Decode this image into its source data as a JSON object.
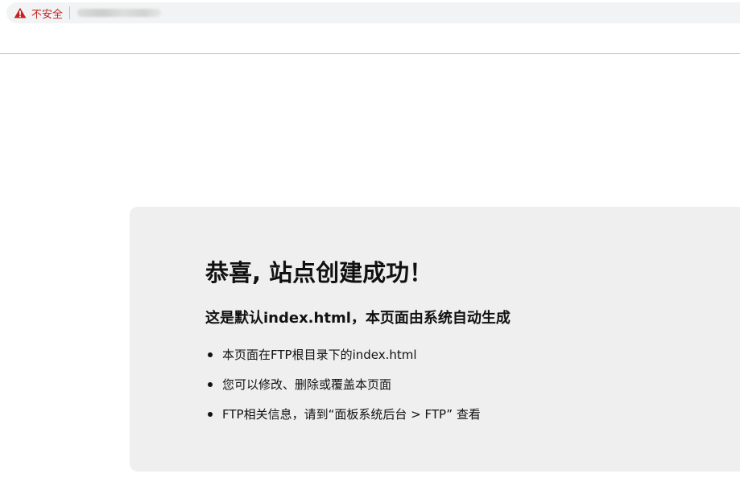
{
  "browser": {
    "security_label": "不安全",
    "warning_icon": "warning-triangle-icon",
    "warning_color": "#c5221f"
  },
  "content": {
    "title": "恭喜, 站点创建成功！",
    "subtitle": "这是默认index.html，本页面由系统自动生成",
    "items": [
      "本页面在FTP根目录下的index.html",
      "您可以修改、删除或覆盖本页面",
      "FTP相关信息，请到“面板系统后台 > FTP” 查看"
    ]
  },
  "colors": {
    "card_background": "#efefef",
    "text": "#111111"
  }
}
